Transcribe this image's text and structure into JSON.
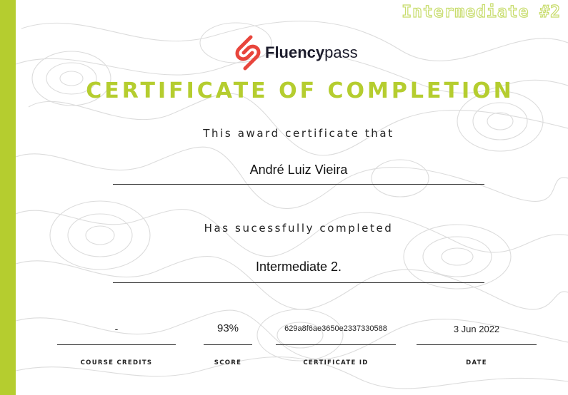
{
  "accent_color": "#b5cd2f",
  "logo_color": "#e8453c",
  "level_tag": "Intermediate #2",
  "brand": {
    "part1": "Fluency",
    "part2": "pass",
    "icon": "fluencypass-logo-icon"
  },
  "title": "CERTIFICATE OF COMPLETION",
  "award_line": "This award certificate that",
  "recipient": "André Luiz Vieira",
  "completed_line": "Has sucessfully completed",
  "course": "Intermediate 2.",
  "fields": [
    {
      "value": "-",
      "label": "COURSE CREDITS"
    },
    {
      "value": "93%",
      "label": "SCORE"
    },
    {
      "value": "629a8f6ae3650e2337330588",
      "label": "CERTIFICATE ID"
    },
    {
      "value": "3 Jun 2022",
      "label": "DATE"
    }
  ]
}
